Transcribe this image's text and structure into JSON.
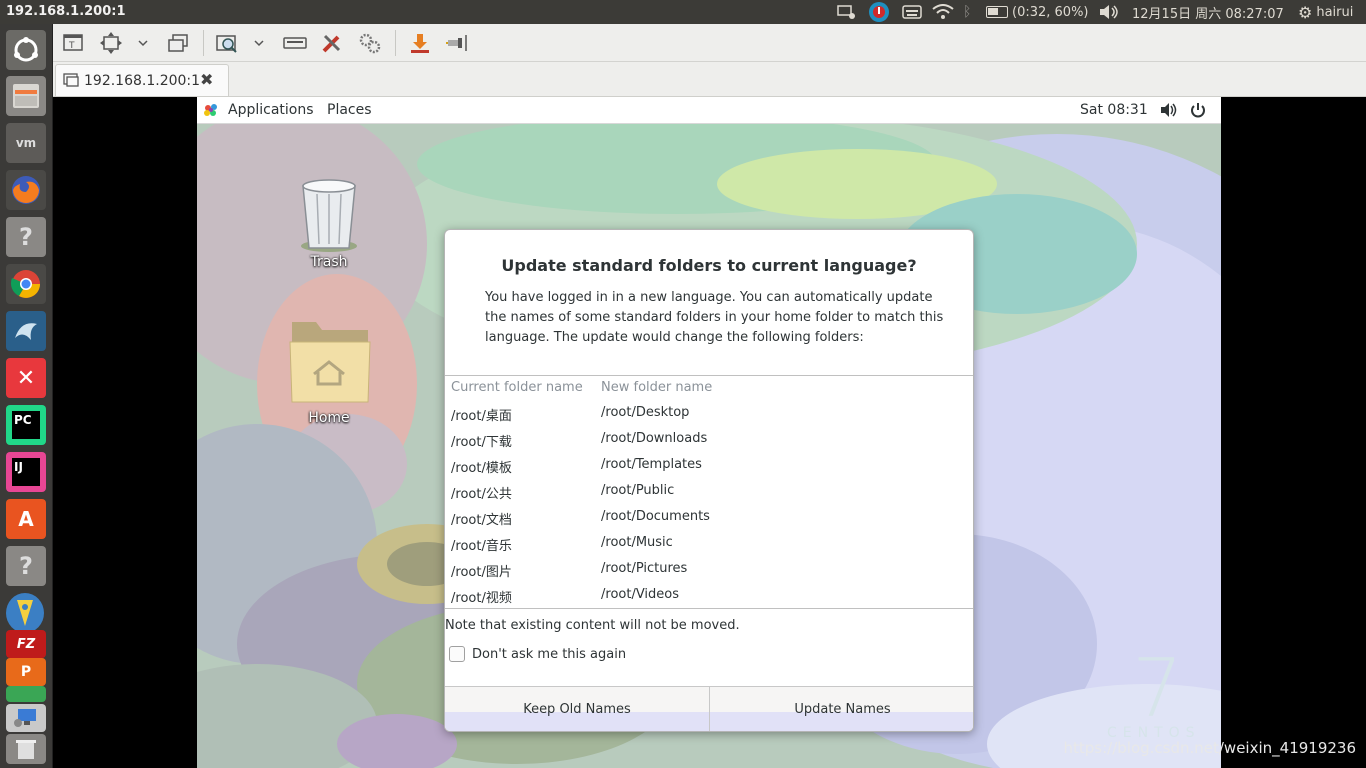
{
  "host_topbar": {
    "title": "192.168.1.200:1",
    "battery": "(0:32, 60%)",
    "datetime": "12月15日 周六 08:27:07",
    "user": "hairui"
  },
  "vnc": {
    "tab_title": "192.168.1.200:1"
  },
  "gnome_bar": {
    "applications": "Applications",
    "places": "Places",
    "clock": "Sat 08:31"
  },
  "desktop": {
    "trash_label": "Trash",
    "home_label": "Home",
    "centos_text": "CENTOS",
    "centos_version": "7"
  },
  "dialog": {
    "title": "Update standard folders to current language?",
    "message": "You have logged in in a new language. You can automatically update the names of some standard folders in your home folder to match this language. The update would change the following folders:",
    "col_current": "Current folder name",
    "col_new": "New folder name",
    "rows": [
      {
        "current": "/root/桌面",
        "new": "/root/Desktop"
      },
      {
        "current": "/root/下载",
        "new": "/root/Downloads"
      },
      {
        "current": "/root/模板",
        "new": "/root/Templates"
      },
      {
        "current": "/root/公共",
        "new": "/root/Public"
      },
      {
        "current": "/root/文档",
        "new": "/root/Documents"
      },
      {
        "current": "/root/音乐",
        "new": "/root/Music"
      },
      {
        "current": "/root/图片",
        "new": "/root/Pictures"
      },
      {
        "current": "/root/视频",
        "new": "/root/Videos"
      }
    ],
    "note": "Note that existing content will not be moved.",
    "checkbox_label": "Don't ask me this again",
    "checkbox_checked": false,
    "keep_button": "Keep Old Names",
    "update_button": "Update Names"
  },
  "watermark": "https://blog.csdn.net/weixin_41919236",
  "launcher_items": [
    "dash-icon",
    "files-icon",
    "vmware-icon",
    "firefox-icon",
    "unknown-app-icon",
    "chrome-icon",
    "mysql-workbench-icon",
    "xmind-icon",
    "pycharm-icon",
    "intellij-icon",
    "software-center-icon",
    "unknown-app-icon",
    "navicat-icon",
    "filezilla-icon",
    "pdf-editor-icon",
    "remote-desktop-icon",
    "trash-icon"
  ]
}
